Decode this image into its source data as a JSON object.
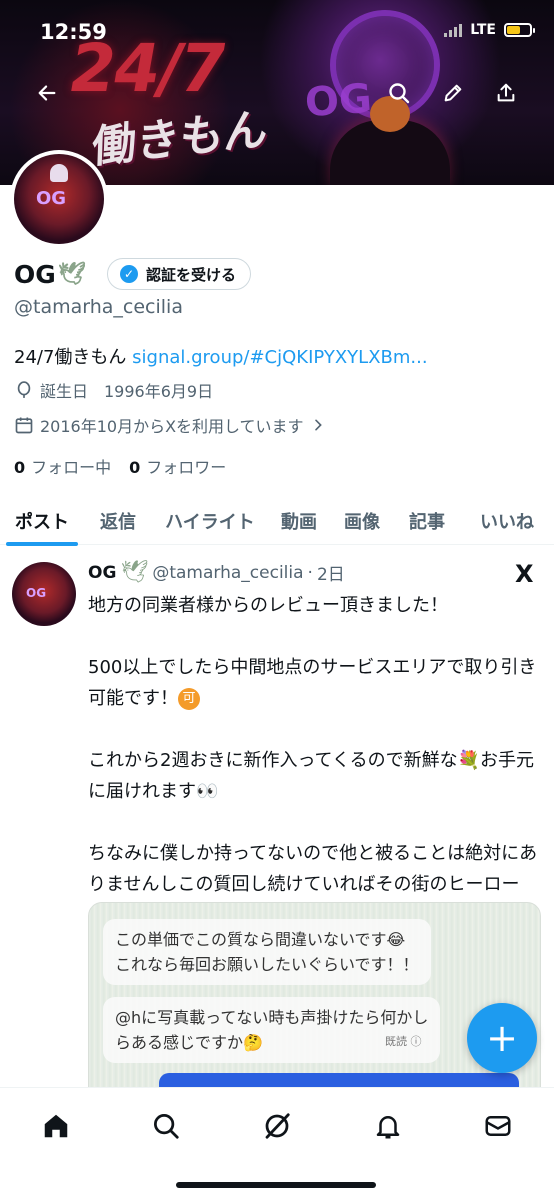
{
  "status_bar": {
    "time": "12:59",
    "network": "LTE",
    "battery_level": 0.6
  },
  "banner": {
    "title_number": "24/7",
    "title_text": "働きもん",
    "logo_text": "OG"
  },
  "profile": {
    "display_name": "OG",
    "name_emoji": "🕊",
    "verify_button_label": "認証を受ける",
    "handle": "@tamarha_cecilia",
    "bio_text": "24/7働きもん ",
    "bio_link": "signal.group/#CjQKIPYXYLXBm...",
    "birthday": "誕生日　1996年6月9日",
    "joined": "2016年10月からXを利用しています",
    "following_count": "0",
    "following_label": "フォロー中",
    "followers_count": "0",
    "followers_label": "フォロワー"
  },
  "tabs": [
    {
      "label": "ポスト",
      "active": true
    },
    {
      "label": "返信",
      "active": false
    },
    {
      "label": "ハイライト",
      "active": false
    },
    {
      "label": "動画",
      "active": false
    },
    {
      "label": "画像",
      "active": false
    },
    {
      "label": "記事",
      "active": false
    },
    {
      "label": "いいね",
      "active": false
    }
  ],
  "post": {
    "author_name": "OG",
    "author_emoji": "🕊",
    "author_handle": "@tamarha_cecilia",
    "time_sep": "·",
    "time": "2日",
    "line1": "地方の同業者様からのレビュー頂きました！",
    "line2a": "500以上でしたら中間地点のサービスエリアで取り引き可能です！",
    "badge": "可",
    "line3a": "これから2週おきに新作入ってくるので新鮮な💐お手元に届けれます👀",
    "line4": "ちなみに僕しか持ってないので他と被ることは絶対にありませんしこの質回し続けていればその街のヒーロー",
    "image_bubble1_line1": "この単価でこの質なら間違いないです😂",
    "image_bubble1_line2": "これなら毎回お願いしたいぐらいです！！",
    "image_bubble2_line1": "@hに写真載ってない時も声掛けたら何かし",
    "image_bubble2_line2": "らある感じですか🤔",
    "image_meta": "既読 ⓘ"
  },
  "fab_label": "+",
  "icons": {
    "back": "arrow-left-icon",
    "search": "search-icon",
    "edit": "pencil-icon",
    "share": "share-icon",
    "x_logo": "X"
  },
  "colors": {
    "accent": "#1d9bf0",
    "secondary_text": "#536471",
    "primary_text": "#0f1419"
  }
}
